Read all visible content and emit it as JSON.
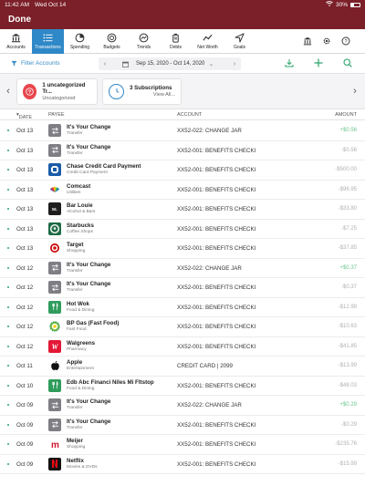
{
  "status": {
    "time": "11:42 AM",
    "date": "Wed Oct 14",
    "battery": "30%"
  },
  "header": {
    "done_label": "Done"
  },
  "tabs": [
    {
      "label": "Accounts",
      "icon": "bank-icon",
      "active": false
    },
    {
      "label": "Transactions",
      "icon": "list-icon",
      "active": true
    },
    {
      "label": "Spending",
      "icon": "pie-chart-icon",
      "active": false
    },
    {
      "label": "Budgets",
      "icon": "budget-icon",
      "active": false
    },
    {
      "label": "Trends",
      "icon": "trends-icon",
      "active": false
    },
    {
      "label": "Debts",
      "icon": "debts-icon",
      "active": false
    },
    {
      "label": "Net Worth",
      "icon": "line-graph-icon",
      "active": false
    },
    {
      "label": "Goals",
      "icon": "navigation-icon",
      "active": false
    }
  ],
  "tab_right_icons": [
    "bank-icon",
    "gear-icon",
    "help-icon"
  ],
  "filterbar": {
    "filter_label": "Filter Accounts",
    "date_range": "Sep 15, 2020 - Oct 14, 2020",
    "actions": [
      "download-icon",
      "add-icon",
      "search-icon"
    ]
  },
  "cards": [
    {
      "title": "1 uncategorized Tr...",
      "subtitle": "Uncategorized",
      "icon": "question-icon",
      "color": "#e8474e"
    },
    {
      "title": "3 Subscriptions",
      "subtitle": "View All...",
      "icon": "clock-icon",
      "color": "#2f88c7"
    }
  ],
  "table": {
    "headers": {
      "date": "DATE",
      "payee": "PAYEE",
      "account": "ACCOUNT",
      "amount": "AMOUNT"
    },
    "rows": [
      {
        "date": "Oct 13",
        "payee": "It's Your Change",
        "category": "Transfer",
        "account": "XX52-022: CHANGE JAR",
        "amount": "+$0.56",
        "positive": true,
        "logo": "transfer-icon",
        "logo_color": "#7e7e84"
      },
      {
        "date": "Oct 13",
        "payee": "It's Your Change",
        "category": "Transfer",
        "account": "XX52-001: BENEFITS CHECKI",
        "amount": "-$0.56",
        "positive": false,
        "logo": "transfer-icon",
        "logo_color": "#7e7e84"
      },
      {
        "date": "Oct 13",
        "payee": "Chase Credit Card Payment",
        "category": "Credit Card Payment",
        "account": "XX52-001: BENEFITS CHECKI",
        "amount": "-$500.00",
        "positive": false,
        "logo": "chase-logo",
        "logo_color": "#1a5ca8"
      },
      {
        "date": "Oct 13",
        "payee": "Comcast",
        "category": "Utilities",
        "account": "XX52-001: BENEFITS CHECKI",
        "amount": "-$96.95",
        "positive": false,
        "logo": "nbc-peacock-logo",
        "logo_color": "#ffffff"
      },
      {
        "date": "Oct 13",
        "payee": "Bar Louie",
        "category": "Alcohol & Bars",
        "account": "XX52-001: BENEFITS CHECKI",
        "amount": "-$33.80",
        "positive": false,
        "logo": "bar-louie-logo",
        "logo_color": "#1d1d1d"
      },
      {
        "date": "Oct 13",
        "payee": "Starbucks",
        "category": "Coffee Shops",
        "account": "XX52-001: BENEFITS CHECKI",
        "amount": "-$7.25",
        "positive": false,
        "logo": "starbucks-logo",
        "logo_color": "#1e6b45"
      },
      {
        "date": "Oct 13",
        "payee": "Target",
        "category": "Shopping",
        "account": "XX52-001: BENEFITS CHECKI",
        "amount": "-$37.85",
        "positive": false,
        "logo": "target-logo",
        "logo_color": "#ffffff"
      },
      {
        "date": "Oct 12",
        "payee": "It's Your Change",
        "category": "Transfer",
        "account": "XX52-022: CHANGE JAR",
        "amount": "+$0.37",
        "positive": true,
        "logo": "transfer-icon",
        "logo_color": "#7e7e84"
      },
      {
        "date": "Oct 12",
        "payee": "It's Your Change",
        "category": "Transfer",
        "account": "XX52-001: BENEFITS CHECKI",
        "amount": "-$0.37",
        "positive": false,
        "logo": "transfer-icon",
        "logo_color": "#7e7e84"
      },
      {
        "date": "Oct 12",
        "payee": "Hot Wok",
        "category": "Food & Dining",
        "account": "XX52-001: BENEFITS CHECKI",
        "amount": "-$12.99",
        "positive": false,
        "logo": "fork-knife-icon",
        "logo_color": "#2f9c5c"
      },
      {
        "date": "Oct 12",
        "payee": "BP Gas (Fast Food)",
        "category": "Fast Food",
        "account": "XX52-001: BENEFITS CHECKI",
        "amount": "-$10.63",
        "positive": false,
        "logo": "bp-logo",
        "logo_color": "#ffffff"
      },
      {
        "date": "Oct 12",
        "payee": "Walgreens",
        "category": "Pharmacy",
        "account": "XX52-001: BENEFITS CHECKI",
        "amount": "-$41.85",
        "positive": false,
        "logo": "walgreens-logo",
        "logo_color": "#e31837"
      },
      {
        "date": "Oct 11",
        "payee": "Apple",
        "category": "Entertainment",
        "account": "CREDIT CARD | 2099",
        "amount": "-$13.99",
        "positive": false,
        "logo": "apple-logo",
        "logo_color": "#ffffff"
      },
      {
        "date": "Oct 10",
        "payee": "Edb Abc Financi Niles Mi Fltstop",
        "category": "Food & Dining",
        "account": "XX52-001: BENEFITS CHECKI",
        "amount": "-$48.03",
        "positive": false,
        "logo": "fork-knife-icon",
        "logo_color": "#2f9c5c"
      },
      {
        "date": "Oct 09",
        "payee": "It's Your Change",
        "category": "Transfer",
        "account": "XX52-022: CHANGE JAR",
        "amount": "+$0.29",
        "positive": true,
        "logo": "transfer-icon",
        "logo_color": "#7e7e84"
      },
      {
        "date": "Oct 09",
        "payee": "It's Your Change",
        "category": "Transfer",
        "account": "XX52-001: BENEFITS CHECKI",
        "amount": "-$0.29",
        "positive": false,
        "logo": "transfer-icon",
        "logo_color": "#7e7e84"
      },
      {
        "date": "Oct 09",
        "payee": "Meijer",
        "category": "Shopping",
        "account": "XX52-001: BENEFITS CHECKI",
        "amount": "-$235.76",
        "positive": false,
        "logo": "meijer-logo",
        "logo_color": "#ffffff"
      },
      {
        "date": "Oct 09",
        "payee": "Netflix",
        "category": "Movies & DVDs",
        "account": "XX52-001: BENEFITS CHECKI",
        "amount": "-$15.99",
        "positive": false,
        "logo": "netflix-logo",
        "logo_color": "#111111"
      }
    ]
  }
}
